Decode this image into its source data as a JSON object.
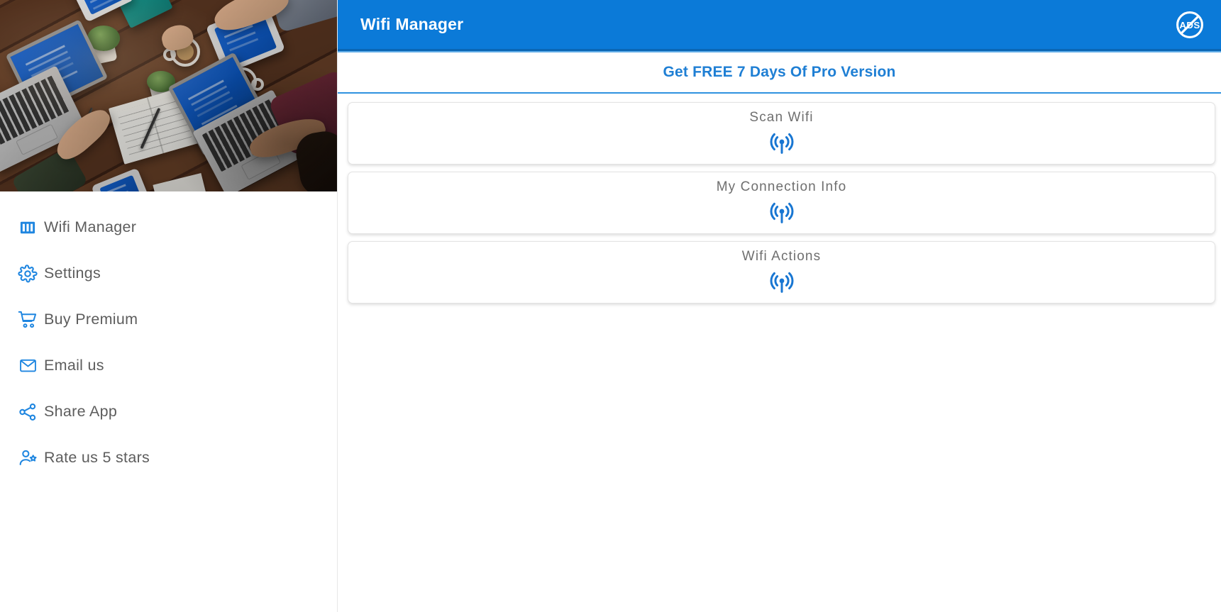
{
  "app": {
    "title": "Wifi Manager",
    "accent_blue": "#0b7ad8",
    "icon_blue": "#1876d2",
    "label_grey": "#6f6f6f"
  },
  "appbar": {
    "title": "Wifi Manager",
    "no_ads_badge": {
      "name": "no-ads-icon",
      "text": "ADS"
    }
  },
  "promo": {
    "label": "Get FREE 7 Days Of Pro Version"
  },
  "sidebar": {
    "header_image_alt": "desk-photo",
    "items": [
      {
        "label": "Wifi Manager",
        "icon": "signal-bars-icon"
      },
      {
        "label": "Settings",
        "icon": "gear-icon"
      },
      {
        "label": "Buy Premium",
        "icon": "shopping-cart-icon"
      },
      {
        "label": "Email us",
        "icon": "envelope-icon"
      },
      {
        "label": "Share App",
        "icon": "share-icon"
      },
      {
        "label": "Rate us 5 stars",
        "icon": "person-star-icon"
      }
    ]
  },
  "main": {
    "cards": [
      {
        "title": "Scan Wifi",
        "icon": "broadcast-icon"
      },
      {
        "title": "My Connection Info",
        "icon": "broadcast-icon"
      },
      {
        "title": "Wifi Actions",
        "icon": "broadcast-icon"
      }
    ]
  }
}
